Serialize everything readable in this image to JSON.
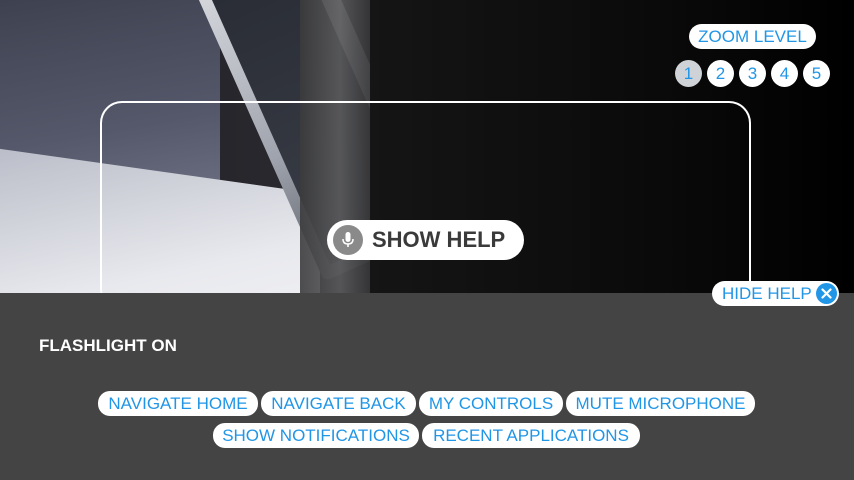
{
  "zoom": {
    "label": "ZOOM LEVEL",
    "levels": [
      "1",
      "2",
      "3",
      "4",
      "5"
    ],
    "active_level": "1"
  },
  "show_help": {
    "label": "SHOW HELP",
    "icon": "microphone-icon"
  },
  "hide_help": {
    "label": "HIDE HELP",
    "icon": "close-icon"
  },
  "status": {
    "flashlight": "FLASHLIGHT ON"
  },
  "commands": {
    "navigate_home": "NAVIGATE HOME",
    "navigate_back": "NAVIGATE BACK",
    "my_controls": "MY CONTROLS",
    "mute_microphone": "MUTE MICROPHONE",
    "show_notifications": "SHOW NOTIFICATIONS",
    "recent_applications": "RECENT APPLICATIONS"
  },
  "colors": {
    "accent": "#2196e6",
    "panel": "#444444",
    "pill": "#ffffff"
  }
}
